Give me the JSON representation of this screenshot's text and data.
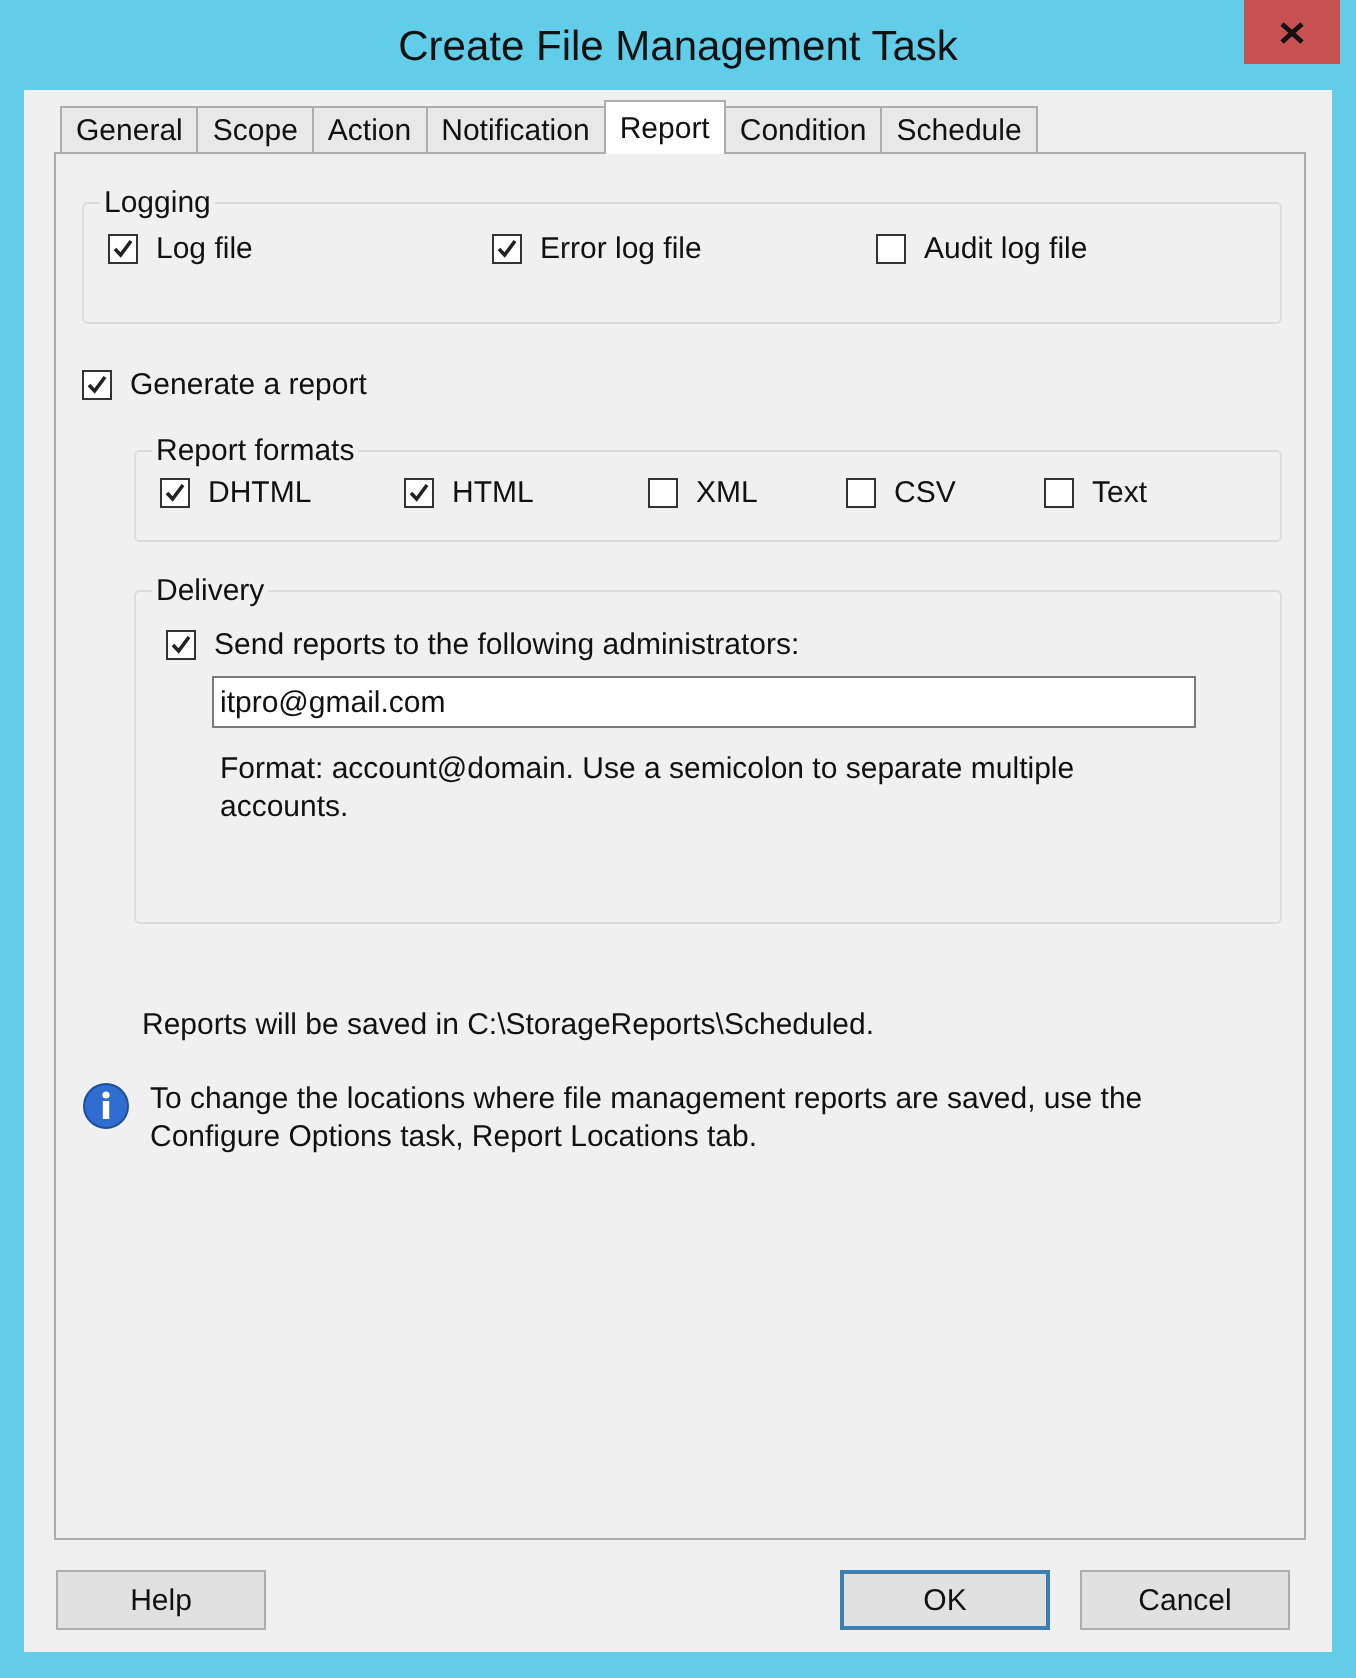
{
  "window": {
    "title": "Create File Management Task"
  },
  "tabs": [
    {
      "label": "General",
      "selected": false
    },
    {
      "label": "Scope",
      "selected": false
    },
    {
      "label": "Action",
      "selected": false
    },
    {
      "label": "Notification",
      "selected": false
    },
    {
      "label": "Report",
      "selected": true
    },
    {
      "label": "Condition",
      "selected": false
    },
    {
      "label": "Schedule",
      "selected": false
    }
  ],
  "logging": {
    "legend": "Logging",
    "options": [
      {
        "label": "Log file",
        "checked": true
      },
      {
        "label": "Error log file",
        "checked": true
      },
      {
        "label": "Audit log file",
        "checked": false
      }
    ]
  },
  "generate_report": {
    "label": "Generate a report",
    "checked": true
  },
  "report_formats": {
    "legend": "Report formats",
    "options": [
      {
        "label": "DHTML",
        "checked": true
      },
      {
        "label": "HTML",
        "checked": true
      },
      {
        "label": "XML",
        "checked": false
      },
      {
        "label": "CSV",
        "checked": false
      },
      {
        "label": "Text",
        "checked": false
      }
    ]
  },
  "delivery": {
    "legend": "Delivery",
    "send": {
      "label": "Send reports to the following administrators:",
      "checked": true
    },
    "email": "itpro@gmail.com",
    "hint": "Format: account@domain. Use a semicolon to separate multiple accounts."
  },
  "saved_note": "Reports will be saved in C:\\StorageReports\\Scheduled.",
  "info": "To change the locations where file management reports are saved, use the Configure Options task, Report Locations tab.",
  "buttons": [
    {
      "label": "Help",
      "default": false
    },
    {
      "label": "OK",
      "default": true
    },
    {
      "label": "Cancel",
      "default": false
    }
  ]
}
